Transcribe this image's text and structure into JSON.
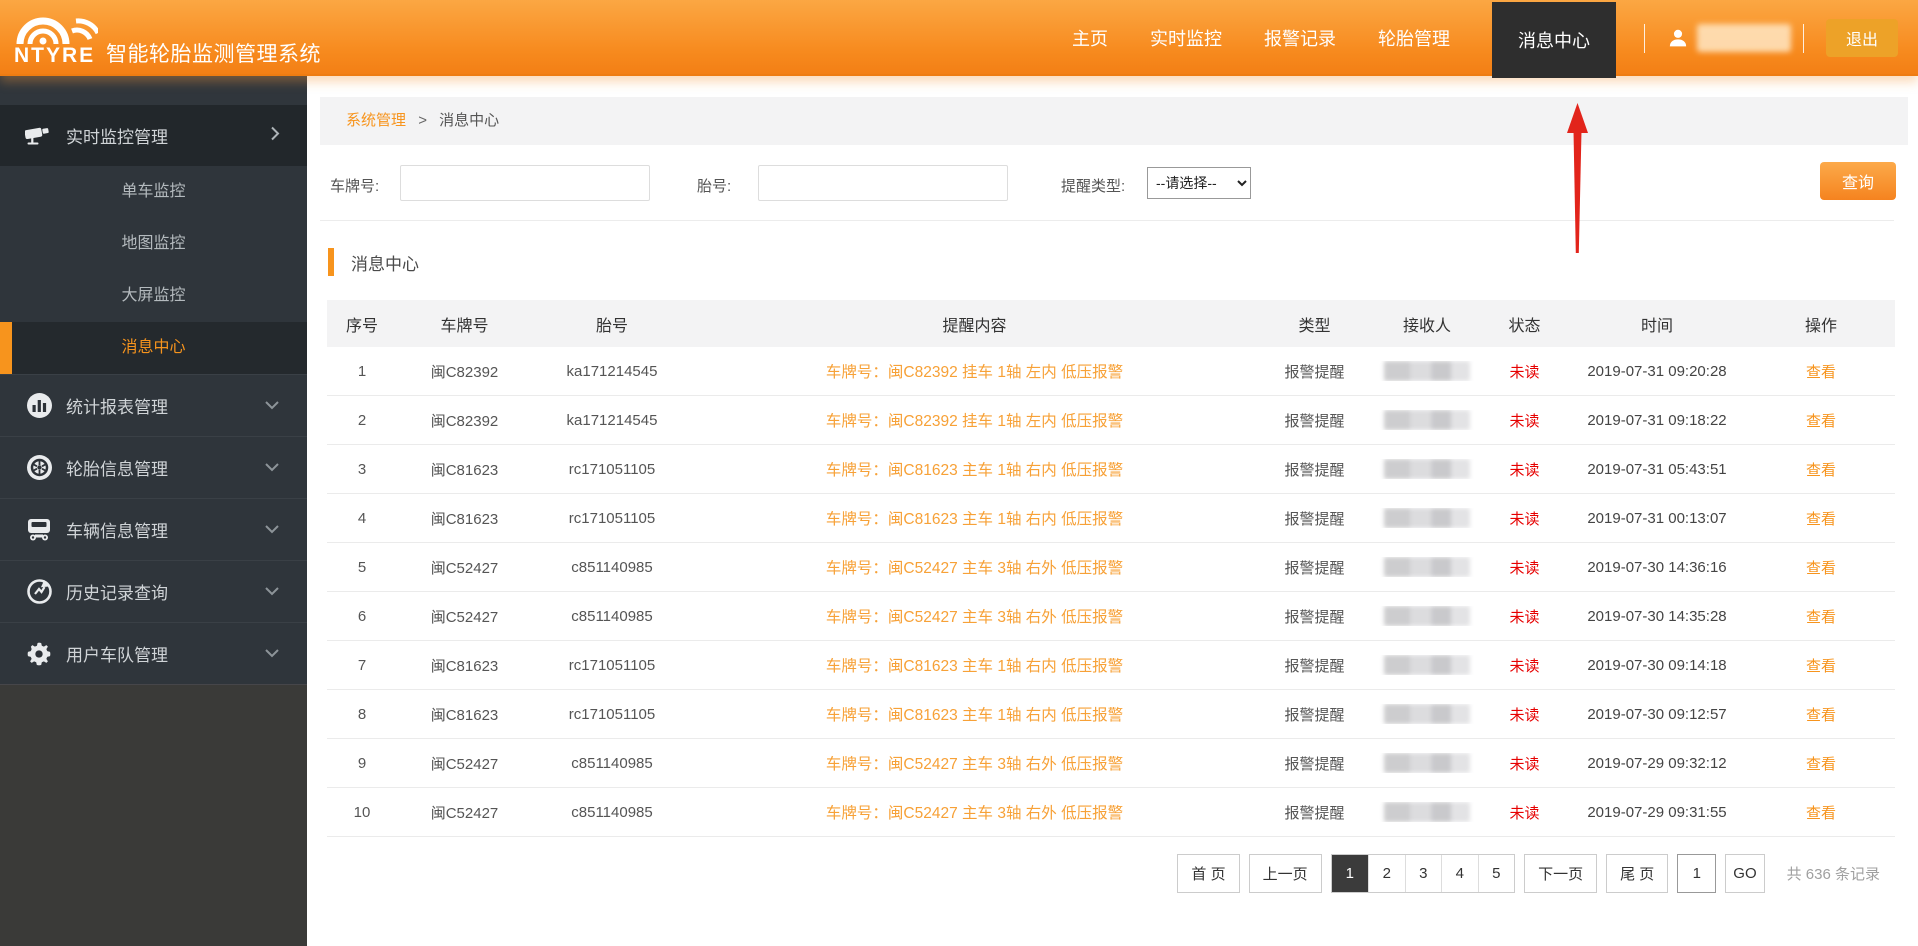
{
  "header": {
    "logo_text": "NTYRE",
    "app_title": "智能轮胎监测管理系统",
    "nav": [
      {
        "label": "主页",
        "active": false
      },
      {
        "label": "实时监控",
        "active": false
      },
      {
        "label": "报警记录",
        "active": false
      },
      {
        "label": "轮胎管理",
        "active": false
      },
      {
        "label": "消息中心",
        "active": true
      }
    ],
    "logout_label": "退出"
  },
  "sidebar": {
    "groups": [
      {
        "label": "实时监控管理",
        "icon": "camera-icon",
        "expanded": true,
        "children": [
          {
            "label": "单车监控",
            "active": false
          },
          {
            "label": "地图监控",
            "active": false
          },
          {
            "label": "大屏监控",
            "active": false
          },
          {
            "label": "消息中心",
            "active": true
          }
        ]
      },
      {
        "label": "统计报表管理",
        "icon": "chart-icon",
        "expanded": false,
        "children": []
      },
      {
        "label": "轮胎信息管理",
        "icon": "tire-icon",
        "expanded": false,
        "children": []
      },
      {
        "label": "车辆信息管理",
        "icon": "truck-icon",
        "expanded": false,
        "children": []
      },
      {
        "label": "历史记录查询",
        "icon": "history-icon",
        "expanded": false,
        "children": []
      },
      {
        "label": "用户车队管理",
        "icon": "gear-icon",
        "expanded": false,
        "children": []
      }
    ]
  },
  "breadcrumb": {
    "parent": "系统管理",
    "separator": ">",
    "current": "消息中心"
  },
  "filters": {
    "plate_label": "车牌号:",
    "tire_label": "胎号:",
    "type_label": "提醒类型:",
    "type_selected": "--请选择--",
    "search_label": "查询"
  },
  "section": {
    "title": "消息中心"
  },
  "table": {
    "columns": [
      "序号",
      "车牌号",
      "胎号",
      "提醒内容",
      "类型",
      "接收人",
      "状态",
      "时间",
      "操作"
    ],
    "rows": [
      {
        "no": "1",
        "plate": "闽C82392",
        "tire": "ka171214545",
        "content": "车牌号：闽C82392 挂车 1轴 左内 低压报警",
        "type": "报警提醒",
        "status": "未读",
        "time": "2019-07-31 09:20:28",
        "action": "查看"
      },
      {
        "no": "2",
        "plate": "闽C82392",
        "tire": "ka171214545",
        "content": "车牌号：闽C82392 挂车 1轴 左内 低压报警",
        "type": "报警提醒",
        "status": "未读",
        "time": "2019-07-31 09:18:22",
        "action": "查看"
      },
      {
        "no": "3",
        "plate": "闽C81623",
        "tire": "rc171051105",
        "content": "车牌号：闽C81623 主车 1轴 右内 低压报警",
        "type": "报警提醒",
        "status": "未读",
        "time": "2019-07-31 05:43:51",
        "action": "查看"
      },
      {
        "no": "4",
        "plate": "闽C81623",
        "tire": "rc171051105",
        "content": "车牌号：闽C81623 主车 1轴 右内 低压报警",
        "type": "报警提醒",
        "status": "未读",
        "time": "2019-07-31 00:13:07",
        "action": "查看"
      },
      {
        "no": "5",
        "plate": "闽C52427",
        "tire": "c851140985",
        "content": "车牌号：闽C52427 主车 3轴 右外 低压报警",
        "type": "报警提醒",
        "status": "未读",
        "time": "2019-07-30 14:36:16",
        "action": "查看"
      },
      {
        "no": "6",
        "plate": "闽C52427",
        "tire": "c851140985",
        "content": "车牌号：闽C52427 主车 3轴 右外 低压报警",
        "type": "报警提醒",
        "status": "未读",
        "time": "2019-07-30 14:35:28",
        "action": "查看"
      },
      {
        "no": "7",
        "plate": "闽C81623",
        "tire": "rc171051105",
        "content": "车牌号：闽C81623 主车 1轴 右内 低压报警",
        "type": "报警提醒",
        "status": "未读",
        "time": "2019-07-30 09:14:18",
        "action": "查看"
      },
      {
        "no": "8",
        "plate": "闽C81623",
        "tire": "rc171051105",
        "content": "车牌号：闽C81623 主车 1轴 右内 低压报警",
        "type": "报警提醒",
        "status": "未读",
        "time": "2019-07-30 09:12:57",
        "action": "查看"
      },
      {
        "no": "9",
        "plate": "闽C52427",
        "tire": "c851140985",
        "content": "车牌号：闽C52427 主车 3轴 右外 低压报警",
        "type": "报警提醒",
        "status": "未读",
        "time": "2019-07-29 09:32:12",
        "action": "查看"
      },
      {
        "no": "10",
        "plate": "闽C52427",
        "tire": "c851140985",
        "content": "车牌号：闽C52427 主车 3轴 右外 低压报警",
        "type": "报警提醒",
        "status": "未读",
        "time": "2019-07-29 09:31:55",
        "action": "查看"
      }
    ]
  },
  "pagination": {
    "first": "首 页",
    "prev": "上一页",
    "pages": [
      "1",
      "2",
      "3",
      "4",
      "5"
    ],
    "active_page": "1",
    "next": "下一页",
    "last": "尾 页",
    "goto_value": "1",
    "go_label": "GO",
    "total": "共 636 条记录"
  },
  "annotation": {
    "arrow_color": "#e2241b"
  }
}
